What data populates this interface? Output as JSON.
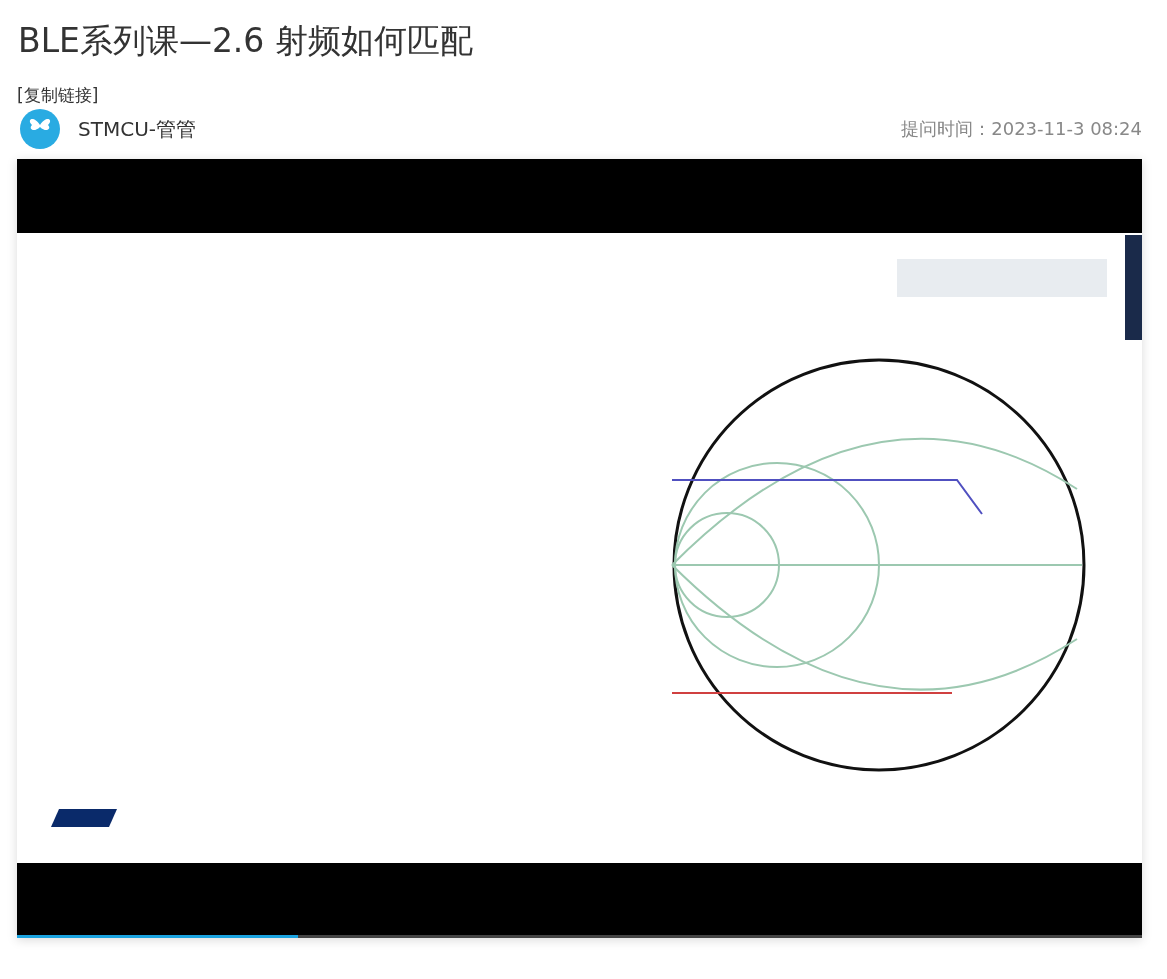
{
  "title": "BLE系列课—2.6 射频如何匹配",
  "copy_link": "[复制链接]",
  "author": {
    "name": "STMCU-管管"
  },
  "asked_time": "提问时间：2023-11-3 08:24",
  "video": {
    "kind": "picture",
    "progress": {
      "level": 0.25
    }
  }
}
